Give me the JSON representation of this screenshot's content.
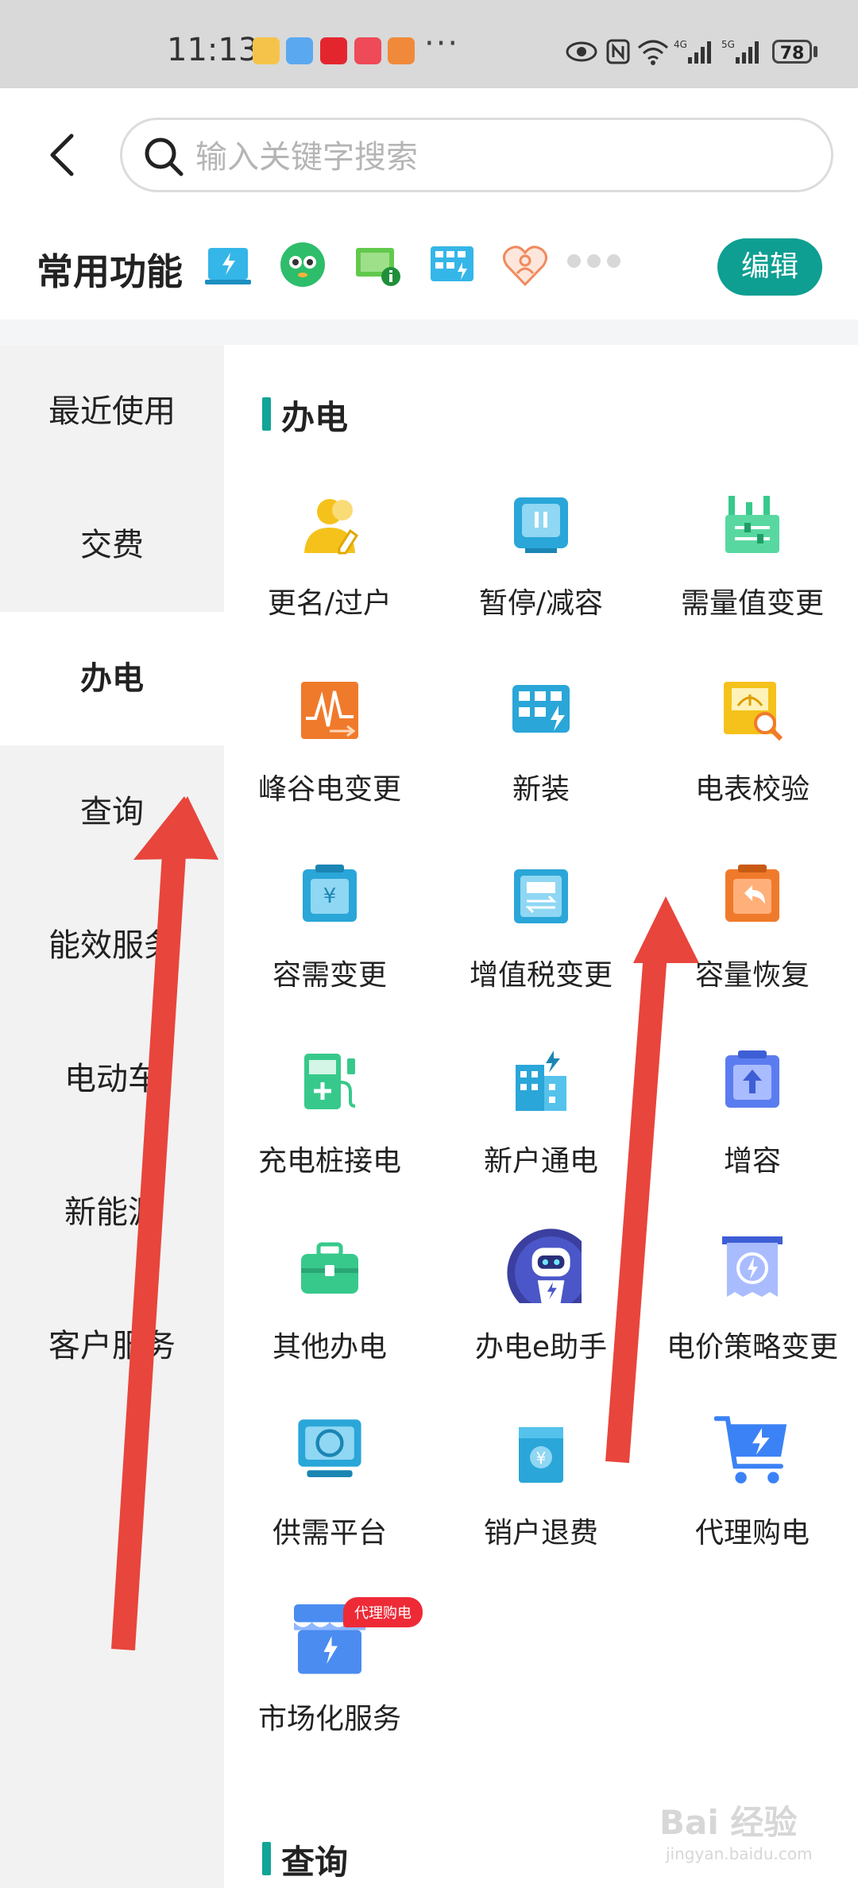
{
  "status_bar": {
    "time": "11:13",
    "more": "···",
    "battery": "78",
    "network_labels": [
      "4G",
      "5G"
    ]
  },
  "header": {
    "search_placeholder": "输入关键字搜索"
  },
  "favorites": {
    "title": "常用功能",
    "edit_label": "编辑"
  },
  "sidebar": {
    "items": [
      {
        "label": "最近使用"
      },
      {
        "label": "交费"
      },
      {
        "label": "办电"
      },
      {
        "label": "查询"
      },
      {
        "label": "能效服务"
      },
      {
        "label": "电动车"
      },
      {
        "label": "新能源"
      },
      {
        "label": "客户服务"
      }
    ],
    "active": "办电"
  },
  "section": {
    "title": "办电",
    "items": [
      {
        "label": "更名/过户",
        "icon": "person-edit-icon",
        "color": "#f5c21b"
      },
      {
        "label": "暂停/减容",
        "icon": "pause-meter-icon",
        "color": "#2aa6d8"
      },
      {
        "label": "需量值变更",
        "icon": "factory-adjust-icon",
        "color": "#37c98b"
      },
      {
        "label": "峰谷电变更",
        "icon": "peak-valley-icon",
        "color": "#f07a2b"
      },
      {
        "label": "新装",
        "icon": "new-install-icon",
        "color": "#2aa6d8"
      },
      {
        "label": "电表校验",
        "icon": "meter-check-icon",
        "color": "#f5c21b"
      },
      {
        "label": "容需变更",
        "icon": "capacity-change-icon",
        "color": "#2aa6d8"
      },
      {
        "label": "增值税变更",
        "icon": "tax-change-icon",
        "color": "#2aa6d8"
      },
      {
        "label": "容量恢复",
        "icon": "capacity-restore-icon",
        "color": "#f07a2b"
      },
      {
        "label": "充电桩接电",
        "icon": "charging-pile-icon",
        "color": "#37c98b"
      },
      {
        "label": "新户通电",
        "icon": "new-building-power-icon",
        "color": "#2aa6d8"
      },
      {
        "label": "增容",
        "icon": "capacity-increase-icon",
        "color": "#5b7cf0"
      },
      {
        "label": "其他办电",
        "icon": "toolbox-icon",
        "color": "#37c98b"
      },
      {
        "label": "办电e助手",
        "icon": "robot-assistant-icon",
        "color": "#3b3fa0"
      },
      {
        "label": "电价策略变更",
        "icon": "price-strategy-icon",
        "color": "#5b7cf0"
      },
      {
        "label": "供需平台",
        "icon": "supply-demand-icon",
        "color": "#2aa6d8"
      },
      {
        "label": "销户退费",
        "icon": "account-refund-icon",
        "color": "#2aa6d8"
      },
      {
        "label": "代理购电",
        "icon": "cart-icon",
        "color": "#3b82f6"
      },
      {
        "label": "市场化服务",
        "icon": "market-store-icon",
        "color": "#4a8cf0",
        "tag": "代理购电"
      }
    ]
  },
  "next_section": {
    "title": "查询"
  },
  "watermark": {
    "text": "Bai 经验",
    "sub": "jingyan.baidu.com"
  }
}
